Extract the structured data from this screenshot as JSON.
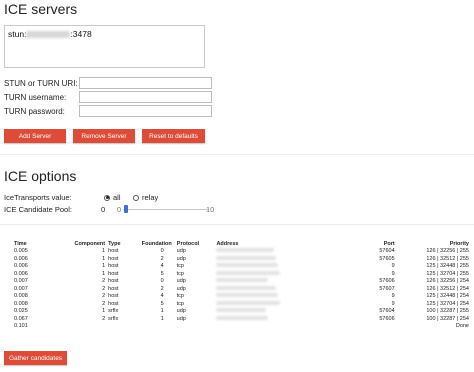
{
  "ice_servers": {
    "title": "ICE servers",
    "server_entry": {
      "prefix": "stun:",
      "suffix": ":3478"
    },
    "form": {
      "uri_label": "STUN or TURN URI:",
      "username_label": "TURN username:",
      "password_label": "TURN password:",
      "uri_value": "",
      "username_value": "",
      "password_value": ""
    },
    "buttons": {
      "add": "Add Server",
      "remove": "Remove Server",
      "reset": "Reset to defaults"
    }
  },
  "ice_options": {
    "title": "ICE options",
    "transports_label": "IceTransports value:",
    "transport_all": "all",
    "transport_relay": "relay",
    "transport_selected": "all",
    "pool_label": "ICE Candidate Pool:",
    "pool_value": "0",
    "pool_min": "0",
    "pool_max": "10",
    "pool_level": 0
  },
  "candidates": {
    "headers": {
      "time": "Time",
      "component": "Component",
      "type": "Type",
      "foundation": "Foundation",
      "protocol": "Protocol",
      "address": "Address",
      "port": "Port",
      "priority": "Priority"
    },
    "rows": [
      {
        "time": "0.005",
        "component": "1",
        "type": "host",
        "foundation": "0",
        "protocol": "udp",
        "port": "57604",
        "priority": "126 | 32256 | 255"
      },
      {
        "time": "0.006",
        "component": "1",
        "type": "host",
        "foundation": "2",
        "protocol": "udp",
        "port": "57605",
        "priority": "126 | 32512 | 255"
      },
      {
        "time": "0.006",
        "component": "1",
        "type": "host",
        "foundation": "4",
        "protocol": "tcp",
        "port": "9",
        "priority": "125 | 32448 | 255"
      },
      {
        "time": "0.006",
        "component": "1",
        "type": "host",
        "foundation": "5",
        "protocol": "tcp",
        "port": "9",
        "priority": "125 | 32704 | 255"
      },
      {
        "time": "0.007",
        "component": "2",
        "type": "host",
        "foundation": "0",
        "protocol": "udp",
        "port": "57606",
        "priority": "126 | 32256 | 254"
      },
      {
        "time": "0.007",
        "component": "2",
        "type": "host",
        "foundation": "2",
        "protocol": "udp",
        "port": "57607",
        "priority": "126 | 32512 | 254"
      },
      {
        "time": "0.008",
        "component": "2",
        "type": "host",
        "foundation": "4",
        "protocol": "tcp",
        "port": "9",
        "priority": "125 | 32448 | 254"
      },
      {
        "time": "0.008",
        "component": "2",
        "type": "host",
        "foundation": "5",
        "protocol": "tcp",
        "port": "9",
        "priority": "125 | 32704 | 254"
      },
      {
        "time": "0.025",
        "component": "1",
        "type": "srflx",
        "foundation": "1",
        "protocol": "udp",
        "port": "57604",
        "priority": "100 | 32287 | 255"
      },
      {
        "time": "0.067",
        "component": "2",
        "type": "srflx",
        "foundation": "1",
        "protocol": "udp",
        "port": "57606",
        "priority": "100 | 32287 | 254"
      },
      {
        "time": "0.101",
        "component": "",
        "type": "",
        "foundation": "",
        "protocol": "",
        "port": "",
        "priority": "Done"
      }
    ]
  },
  "gather_button": "Gather candidates",
  "colors": {
    "accent": "#dd4b39",
    "slider": "#3b6fd8"
  }
}
